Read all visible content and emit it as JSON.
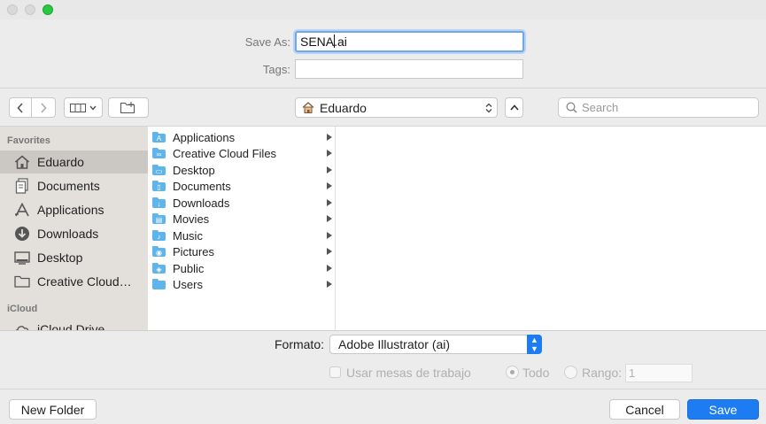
{
  "form": {
    "save_as_label": "Save As:",
    "filename_before_caret": "SENA",
    "filename_after_caret": ".ai",
    "tags_label": "Tags:",
    "tags_value": ""
  },
  "toolbar": {
    "location": "Eduardo",
    "search_placeholder": "Search"
  },
  "sidebar": {
    "favorites_header": "Favorites",
    "items": [
      {
        "label": "Eduardo",
        "icon": "home-icon",
        "selected": true
      },
      {
        "label": "Documents",
        "icon": "documents-icon"
      },
      {
        "label": "Applications",
        "icon": "applications-icon"
      },
      {
        "label": "Downloads",
        "icon": "downloads-icon"
      },
      {
        "label": "Desktop",
        "icon": "desktop-icon"
      },
      {
        "label": "Creative Cloud…",
        "icon": "folder-icon"
      }
    ],
    "icloud_header": "iCloud",
    "icloud_item": "iCloud Drive"
  },
  "files": [
    {
      "name": "Applications"
    },
    {
      "name": "Creative Cloud Files"
    },
    {
      "name": "Desktop"
    },
    {
      "name": "Documents"
    },
    {
      "name": "Downloads"
    },
    {
      "name": "Movies"
    },
    {
      "name": "Music"
    },
    {
      "name": "Pictures"
    },
    {
      "name": "Public"
    },
    {
      "name": "Users"
    }
  ],
  "options": {
    "format_label": "Formato:",
    "format_value": "Adobe Illustrator (ai)",
    "artboards_label": "Usar mesas de trabajo",
    "all_label": "Todo",
    "range_label": "Rango:",
    "range_value": "1"
  },
  "buttons": {
    "new_folder": "New Folder",
    "cancel": "Cancel",
    "save": "Save"
  },
  "colors": {
    "accent": "#1e7cf2",
    "folder": "#5fb4ea",
    "sidebar_bg": "#e3e0dc",
    "sidebar_selected": "#cbc7c2"
  }
}
